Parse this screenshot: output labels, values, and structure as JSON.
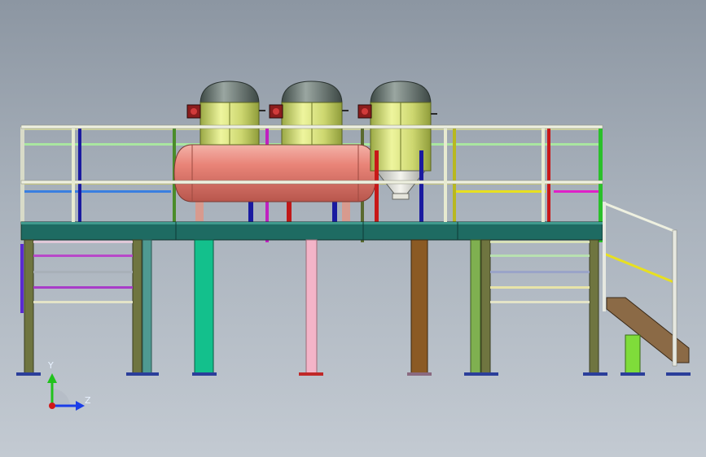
{
  "viewport": {
    "background_top": "#8c96a2",
    "background_bottom": "#c3cad2"
  },
  "triad": {
    "y_label": "Y",
    "z_label": "Z",
    "y_color": "#21c21c",
    "z_color": "#1a3de8",
    "origin_color": "#d01818"
  },
  "model": {
    "vessel_count": 3,
    "tank_count": 1,
    "colors": {
      "vessel_body": "#d6e07a",
      "vessel_head": "#5d6b66",
      "tank": "#e47c72",
      "deck": "#1e6b62",
      "column": "#6f7540",
      "stair": "#8b6a46"
    }
  }
}
